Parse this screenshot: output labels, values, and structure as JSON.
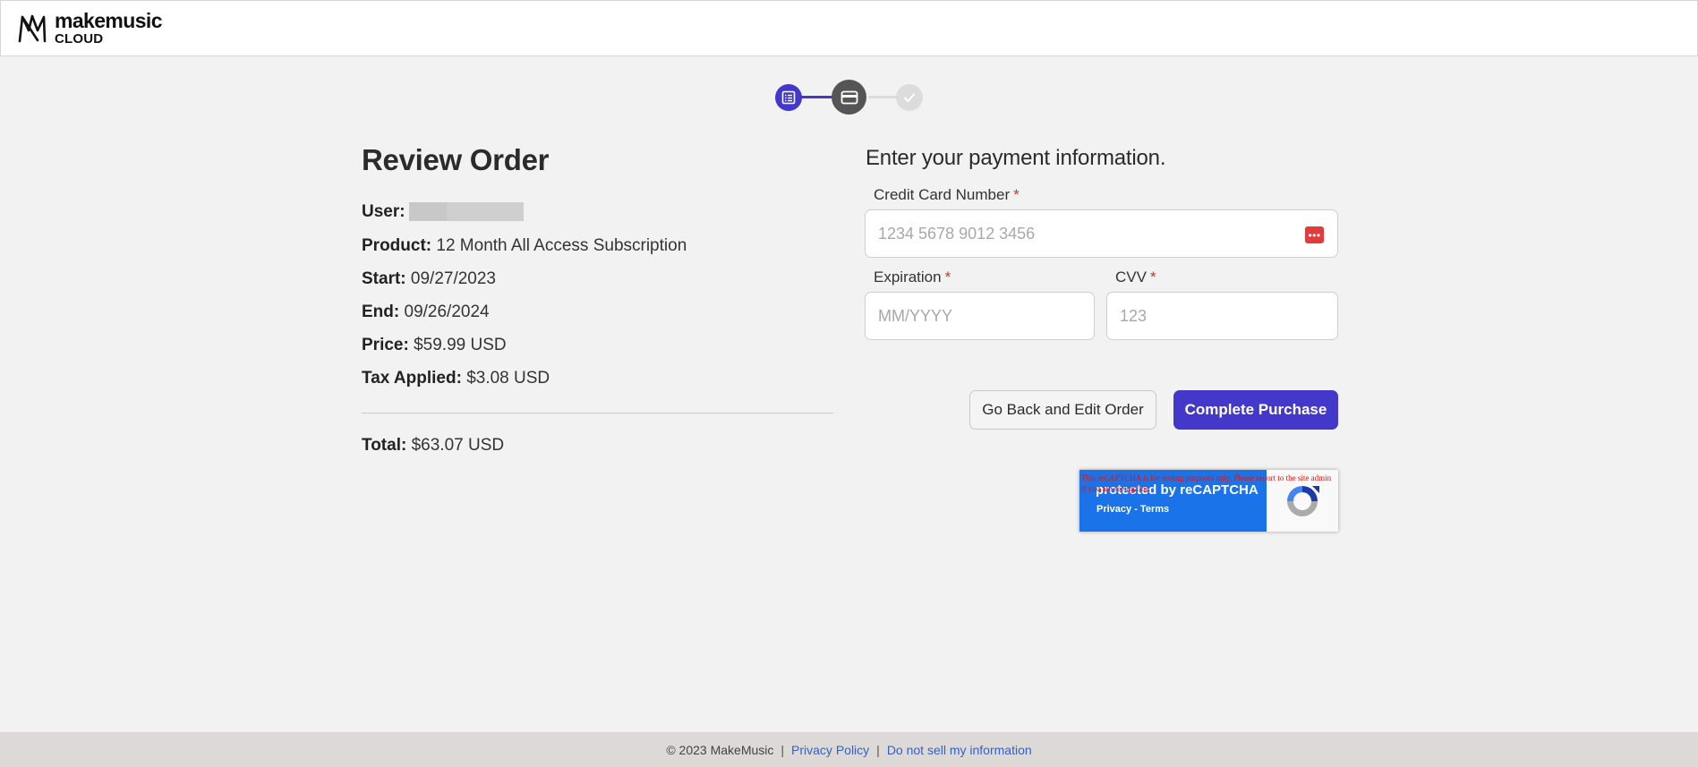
{
  "header": {
    "logo_word": "makemusic",
    "logo_sub": "CLOUD"
  },
  "stepper": {
    "steps": [
      {
        "icon": "list-icon",
        "state": "done"
      },
      {
        "icon": "credit-card-icon",
        "state": "current"
      },
      {
        "icon": "check-icon",
        "state": "pending"
      }
    ],
    "colors": {
      "active": "#4338ca",
      "current": "#555555",
      "pending": "#dcdcdc"
    }
  },
  "review": {
    "title": "Review Order",
    "user_label": "User:",
    "product_label": "Product:",
    "product_value": "12 Month All Access Subscription",
    "start_label": "Start:",
    "start_value": "09/27/2023",
    "end_label": "End:",
    "end_value": "09/26/2024",
    "price_label": "Price:",
    "price_value": "$59.99 USD",
    "tax_label": "Tax Applied:",
    "tax_value": "$3.08 USD",
    "total_label": "Total:",
    "total_value": "$63.07 USD"
  },
  "payment": {
    "title": "Enter your payment information.",
    "cc_label": "Credit Card Number",
    "cc_placeholder": "1234 5678 9012 3456",
    "exp_label": "Expiration",
    "exp_placeholder": "MM/YYYY",
    "cvv_label": "CVV",
    "cvv_placeholder": "123",
    "required_mark": "*",
    "card_icon_glyph": "•••",
    "back_button": "Go Back and Edit Order",
    "purchase_button": "Complete Purchase",
    "accent_color": "#4338ca"
  },
  "recaptcha": {
    "warning": "This reCAPTCHA is for testing purposes only. Please report to the site admin if you are seeing this.",
    "title": "protected by reCAPTCHA",
    "links": "Privacy - Terms"
  },
  "footer": {
    "copyright": "© 2023 MakeMusic",
    "privacy": "Privacy Policy",
    "do_not_sell": "Do not sell my information"
  }
}
